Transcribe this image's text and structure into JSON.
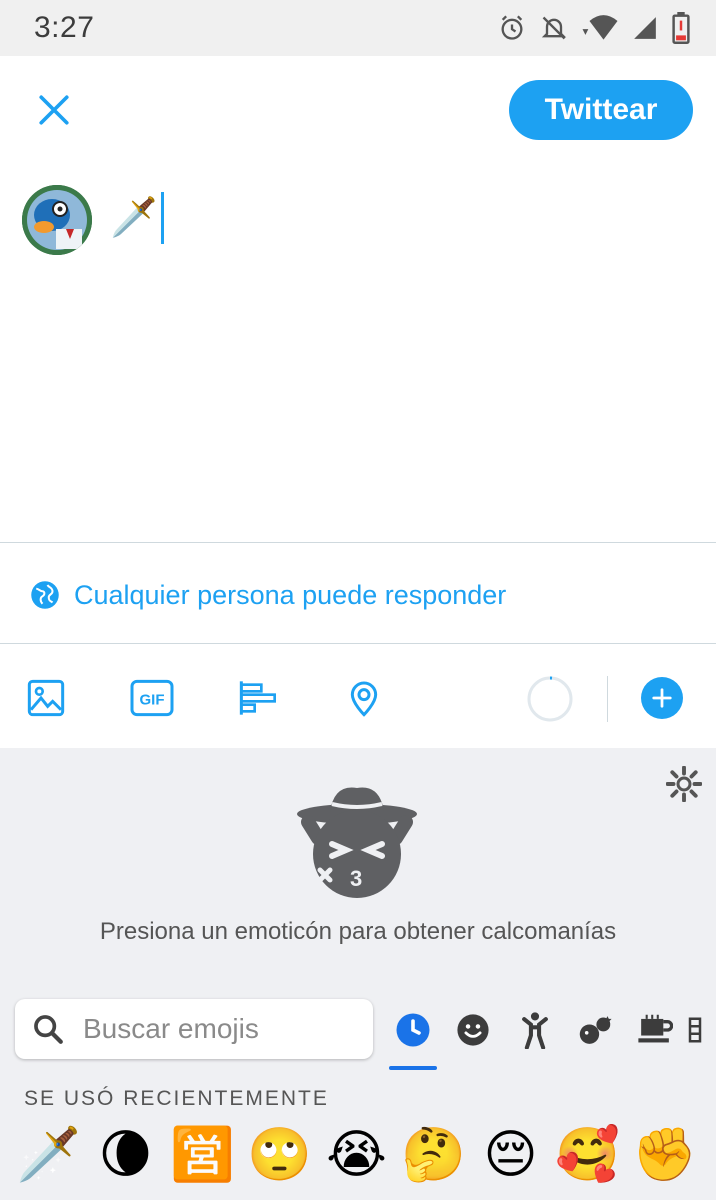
{
  "status_bar": {
    "time": "3:27"
  },
  "header": {
    "close_icon": "close-icon",
    "tweet_button_label": "Twittear"
  },
  "compose": {
    "text": "🗡️"
  },
  "reply_settings": {
    "icon": "globe-icon",
    "label": "Cualquier persona puede responder"
  },
  "toolbar": {
    "items": [
      "image-icon",
      "gif-icon",
      "poll-icon",
      "location-icon"
    ],
    "gif_text": "GIF"
  },
  "keyboard": {
    "sticker_hint": "Presiona un emoticón para obtener calcomanías",
    "search_placeholder": "Buscar emojis",
    "categories": [
      "recent-clock-icon",
      "smiley-icon",
      "person-icon",
      "animals-icon",
      "food-icon",
      "more-icon"
    ],
    "recent_label": "SE USÓ RECIENTEMENTE",
    "recent_emojis": [
      "🗡️",
      "🌘",
      "🈺",
      "🙄",
      "😭",
      "🤔",
      "😔",
      "🥰",
      "✊"
    ]
  },
  "colors": {
    "accent": "#1da1f2",
    "keyboard_bg": "#eff0f3",
    "active_tab": "#1a73e8"
  }
}
